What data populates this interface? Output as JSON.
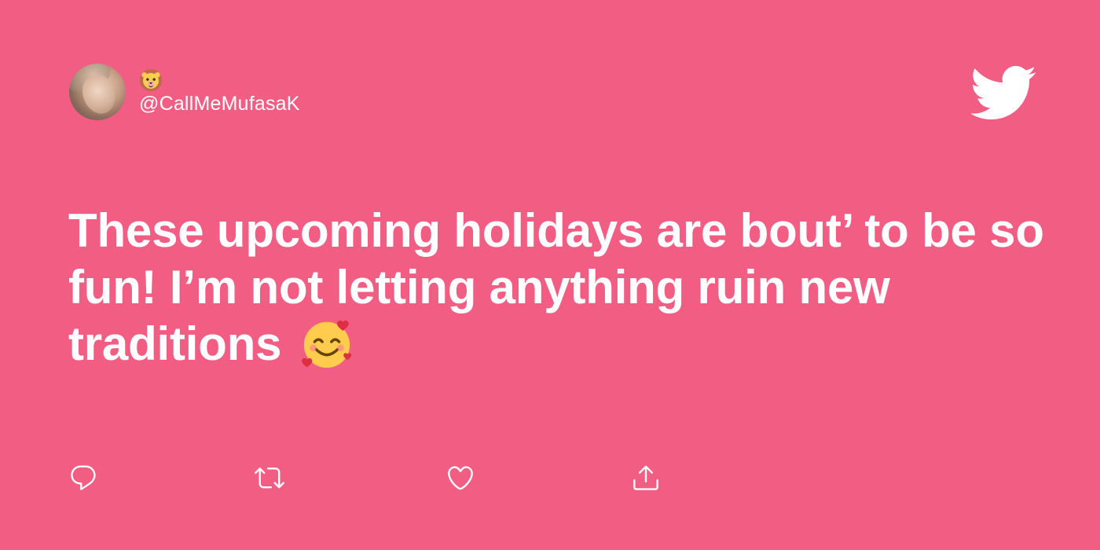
{
  "tweet": {
    "author": {
      "display_name_icon": "lion-face-emoji",
      "handle": "@CallMeMufasaK"
    },
    "text": "These upcoming holidays are bout’ to be so fun! I’m not letting anything ruin new traditions",
    "emoji": "smiling-face-with-hearts-emoji"
  },
  "colors": {
    "background": "#F25E83",
    "foreground": "#FFFFFF"
  },
  "actions": [
    {
      "name": "reply",
      "icon": "reply-icon"
    },
    {
      "name": "retweet",
      "icon": "retweet-icon"
    },
    {
      "name": "like",
      "icon": "heart-icon"
    },
    {
      "name": "share",
      "icon": "share-icon"
    }
  ],
  "brand": {
    "logo": "twitter-bird-icon"
  }
}
